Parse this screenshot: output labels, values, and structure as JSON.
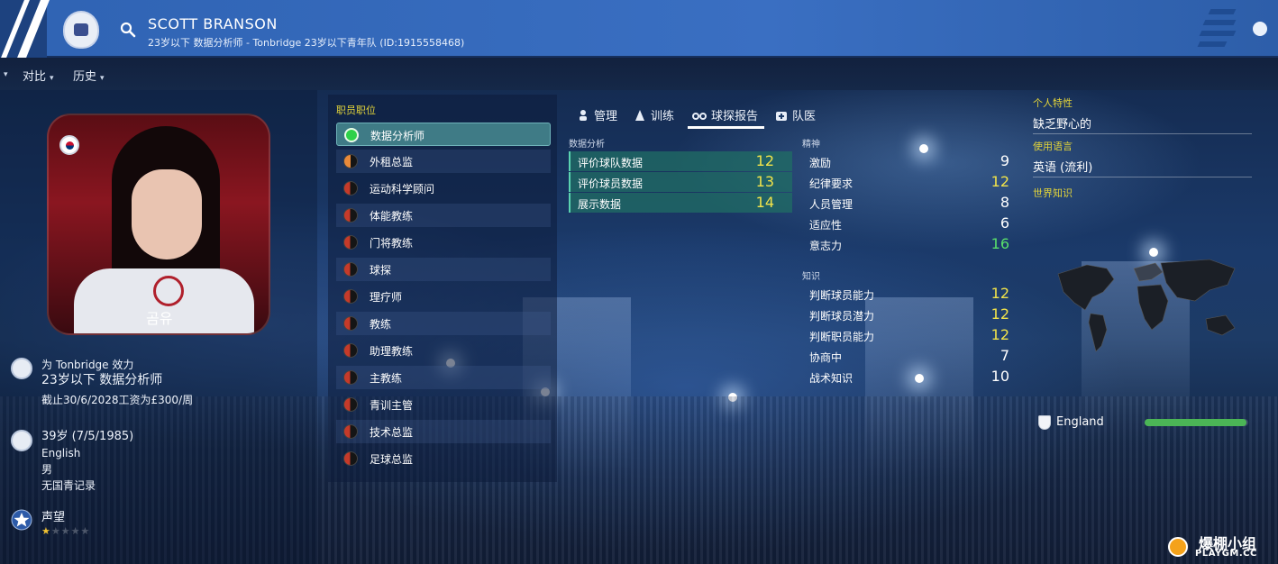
{
  "header": {
    "name": "SCOTT BRANSON",
    "subtitle": "23岁以下 数据分析师 - Tonbridge 23岁以下青年队 (ID:1915558468)"
  },
  "subnav": {
    "items": [
      {
        "label": "对比"
      },
      {
        "label": "历史"
      }
    ]
  },
  "profile": {
    "portrait_caption": "곰유",
    "club_line": "为 Tonbridge 效力",
    "role_line": "23岁以下 数据分析师",
    "contract_line": "截止30/6/2028工资为£300/周",
    "age_line": "39岁 (7/5/1985)",
    "nationality": "English",
    "gender": "男",
    "youth_record": "无国青记录",
    "reputation_label": "声望",
    "reputation_stars": 1,
    "reputation_max": 5
  },
  "roles": {
    "title": "职员职位",
    "items": [
      {
        "label": "数据分析师",
        "color": "#2ed14a",
        "selected": true
      },
      {
        "label": "外租总监",
        "color": "orange-half"
      },
      {
        "label": "运动科学顾问",
        "color": "red-half"
      },
      {
        "label": "体能教练",
        "color": "red-half"
      },
      {
        "label": "门将教练",
        "color": "red-half"
      },
      {
        "label": "球探",
        "color": "red-half"
      },
      {
        "label": "理疗师",
        "color": "red-half"
      },
      {
        "label": "教练",
        "color": "red-half"
      },
      {
        "label": "助理教练",
        "color": "red-half"
      },
      {
        "label": "主教练",
        "color": "red-half"
      },
      {
        "label": "青训主管",
        "color": "red-half"
      },
      {
        "label": "技术总监",
        "color": "red-half"
      },
      {
        "label": "足球总监",
        "color": "red-half"
      }
    ]
  },
  "tabs": [
    {
      "label": "管理",
      "icon": "management-icon"
    },
    {
      "label": "训练",
      "icon": "training-icon"
    },
    {
      "label": "球探报告",
      "icon": "binoculars-icon",
      "active": true
    },
    {
      "label": "队医",
      "icon": "medical-icon"
    }
  ],
  "attributes": {
    "data_analysis": {
      "title": "数据分析",
      "rows": [
        {
          "name": "评价球队数据",
          "value": "12"
        },
        {
          "name": "评价球员数据",
          "value": "13"
        },
        {
          "name": "展示数据",
          "value": "14"
        }
      ]
    },
    "mental": {
      "title": "精神",
      "rows": [
        {
          "name": "激励",
          "value": "9"
        },
        {
          "name": "纪律要求",
          "value": "12"
        },
        {
          "name": "人员管理",
          "value": "8"
        },
        {
          "name": "适应性",
          "value": "6"
        },
        {
          "name": "意志力",
          "value": "16"
        }
      ]
    },
    "knowledge": {
      "title": "知识",
      "rows": [
        {
          "name": "判断球员能力",
          "value": "12"
        },
        {
          "name": "判断球员潜力",
          "value": "12"
        },
        {
          "name": "判断职员能力",
          "value": "12"
        },
        {
          "name": "协商中",
          "value": "7"
        },
        {
          "name": "战术知识",
          "value": "10"
        }
      ]
    }
  },
  "right": {
    "traits_title": "个人特性",
    "traits_value": "缺乏野心的",
    "languages_title": "使用语言",
    "languages_value": "英语 (流利)",
    "world_title": "世界知识",
    "country": "England",
    "country_knowledge": 0.98
  },
  "watermark": {
    "cn": "爆棚小组",
    "en": "PLAYGM.CC"
  },
  "colors": {
    "header_blue": "#3a6fc2",
    "accent_yellow": "#f1e34a",
    "value_green": "#59e06b",
    "highlight_teal": "#3f7b86"
  }
}
